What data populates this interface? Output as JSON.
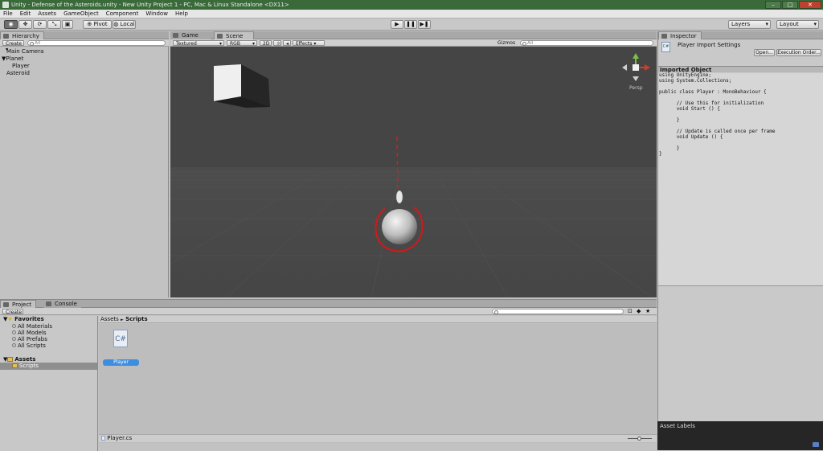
{
  "window": {
    "title": "Unity - Defense of the Asteroids.unity - New Unity Project 1 - PC, Mac & Linux Standalone <DX11>"
  },
  "menu": [
    "File",
    "Edit",
    "Assets",
    "GameObject",
    "Component",
    "Window",
    "Help"
  ],
  "toolbar": {
    "pivot_label": "Pivot",
    "local_label": "Local",
    "layers_label": "Layers",
    "layout_label": "Layout"
  },
  "hierarchy": {
    "tab_label": "Hierarchy",
    "create_label": "Create",
    "search_placeholder": "All",
    "items": [
      {
        "label": "Main Camera"
      },
      {
        "label": "Planet"
      },
      {
        "label": "Player"
      },
      {
        "label": "Asteroid"
      }
    ]
  },
  "scene": {
    "tabs": {
      "game": "Game",
      "scene": "Scene"
    },
    "render_mode": "Textured",
    "color_mode": "RGB",
    "mode_2d": "2D",
    "effects_label": "Effects",
    "gizmos_label": "Gizmos",
    "search_placeholder": "All",
    "persp_label": "Persp"
  },
  "inspector": {
    "tab_label": "Inspector",
    "title": "Player Import Settings",
    "open_label": "Open...",
    "exec_order_label": "Execution Order...",
    "imported_object_label": "Imported Object",
    "code": "using UnityEngine;\nusing System.Collections;\n\npublic class Player : MonoBehaviour {\n\n\t// Use this for initialization\n\tvoid Start () {\n\n\t}\n\n\t// Update is called once per frame\n\tvoid Update () {\n\n\t}\n}",
    "asset_labels": "Asset Labels"
  },
  "project": {
    "tab_label": "Project",
    "console_tab_label": "Console",
    "create_label": "Create",
    "favorites_label": "Favorites",
    "favorites": [
      "All Materials",
      "All Models",
      "All Prefabs",
      "All Scripts"
    ],
    "assets_label": "Assets",
    "scripts_label": "Scripts",
    "breadcrumb": {
      "root": "Assets",
      "sep": "►",
      "current": "Scripts"
    },
    "file": {
      "name": "Player",
      "icon_text": "C#"
    },
    "footer_path": "Player.cs"
  }
}
